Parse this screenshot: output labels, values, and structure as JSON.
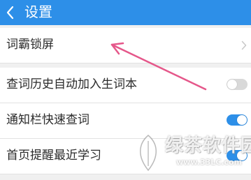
{
  "header": {
    "title": "设置",
    "back_icon": "chevron-left-icon"
  },
  "settings": {
    "items": [
      {
        "label": "词霸锁屏",
        "control": "chevron-right-icon"
      },
      {
        "label": "查词历史自动加入生词本",
        "control": "toggle",
        "enabled": false
      },
      {
        "label": "通知栏快速查词",
        "control": "toggle",
        "enabled": true
      },
      {
        "label": "首页提醒最近学习",
        "control": "toggle",
        "enabled": true
      }
    ]
  },
  "annotation": {
    "arrow_color": "#e5578a",
    "points_to": "词霸锁屏"
  },
  "watermark": {
    "text": "绿茶软件园",
    "url": "www.33LC.com"
  },
  "colors": {
    "accent": "#2d8fe8",
    "background": "#f0f0f0",
    "row_background": "#ffffff",
    "toggle_off": "#d9d9d9"
  }
}
